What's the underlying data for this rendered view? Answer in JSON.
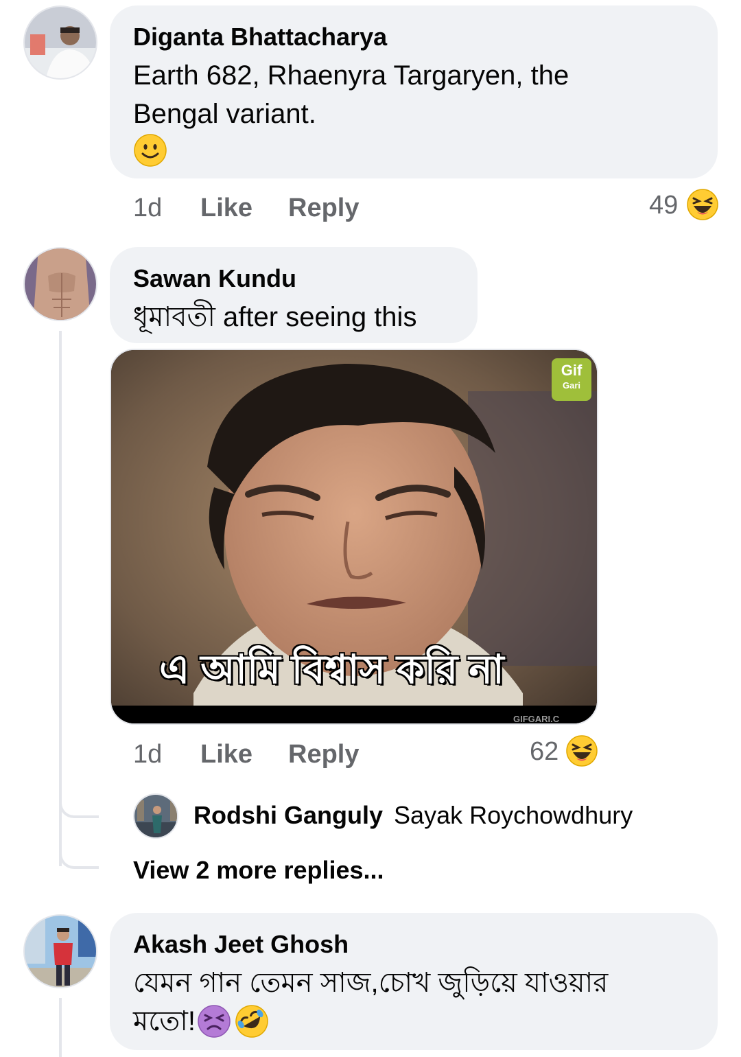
{
  "comments": [
    {
      "author": "Diganta Bhattacharya",
      "text_line1": "Earth 682, Rhaenyra Targaryen, the",
      "text_line2": "Bengal variant.",
      "inline_emoji": "slightly-smiling-face",
      "time": "1d",
      "like_label": "Like",
      "reply_label": "Reply",
      "reaction_count": "49",
      "reaction_icon": "haha-reaction"
    },
    {
      "author": "Sawan Kundu",
      "text": "ধূমাবতী after seeing this",
      "gif_caption": "এ আমি বিশ্বাস করি না",
      "gif_badge_line1": "Gif",
      "gif_badge_line2": "Gari",
      "gif_watermark": "GIFGARI.C",
      "time": "1d",
      "like_label": "Like",
      "reply_label": "Reply",
      "reaction_count": "62",
      "reaction_icon": "haha-reaction",
      "reply_preview": {
        "author": "Rodshi Ganguly",
        "mention": "Sayak Roychowdhury"
      },
      "view_more_label": "View 2 more replies..."
    },
    {
      "author": "Akash Jeet Ghosh",
      "text_line1": "যেমন গান তেমন সাজ,চোখ জুড়িয়ে যাওয়ার",
      "text_line2": "মতো!",
      "inline_emojis": [
        "tired-face",
        "rolling-laughing-face"
      ]
    }
  ],
  "colors": {
    "bubble": "#f0f2f5",
    "meta_text": "#65676b",
    "thread_line": "#e4e6eb",
    "emoji_yellow": "#ffcc33"
  }
}
